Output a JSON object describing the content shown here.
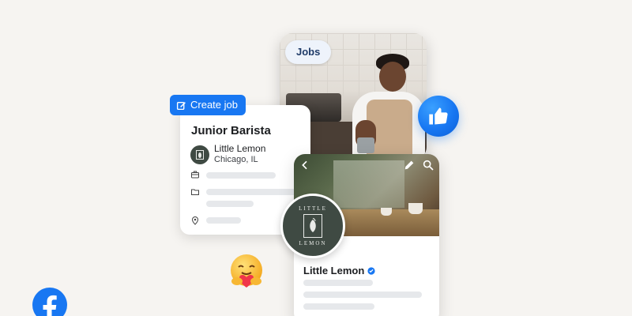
{
  "photo_card": {
    "pill_label": "Jobs"
  },
  "create_job": {
    "label": "Create job"
  },
  "job_card": {
    "title": "Junior Barista",
    "company": "Little Lemon",
    "location": "Chicago, IL"
  },
  "profile_card": {
    "name": "Little Lemon",
    "logo_top": "LITTLE",
    "logo_bottom": "LEMON"
  },
  "colors": {
    "facebook_blue": "#1877f2",
    "brand_green": "#3f4a43",
    "placeholder_bar": "#e6e8eb",
    "background": "#f6f4f1"
  },
  "icons": [
    "thumbs-up-icon",
    "edit-icon",
    "briefcase-icon",
    "folder-icon",
    "location-pin-icon",
    "back-chevron-icon",
    "pencil-icon",
    "search-icon",
    "verified-badge-icon",
    "care-emoji-icon",
    "facebook-logo-icon"
  ]
}
